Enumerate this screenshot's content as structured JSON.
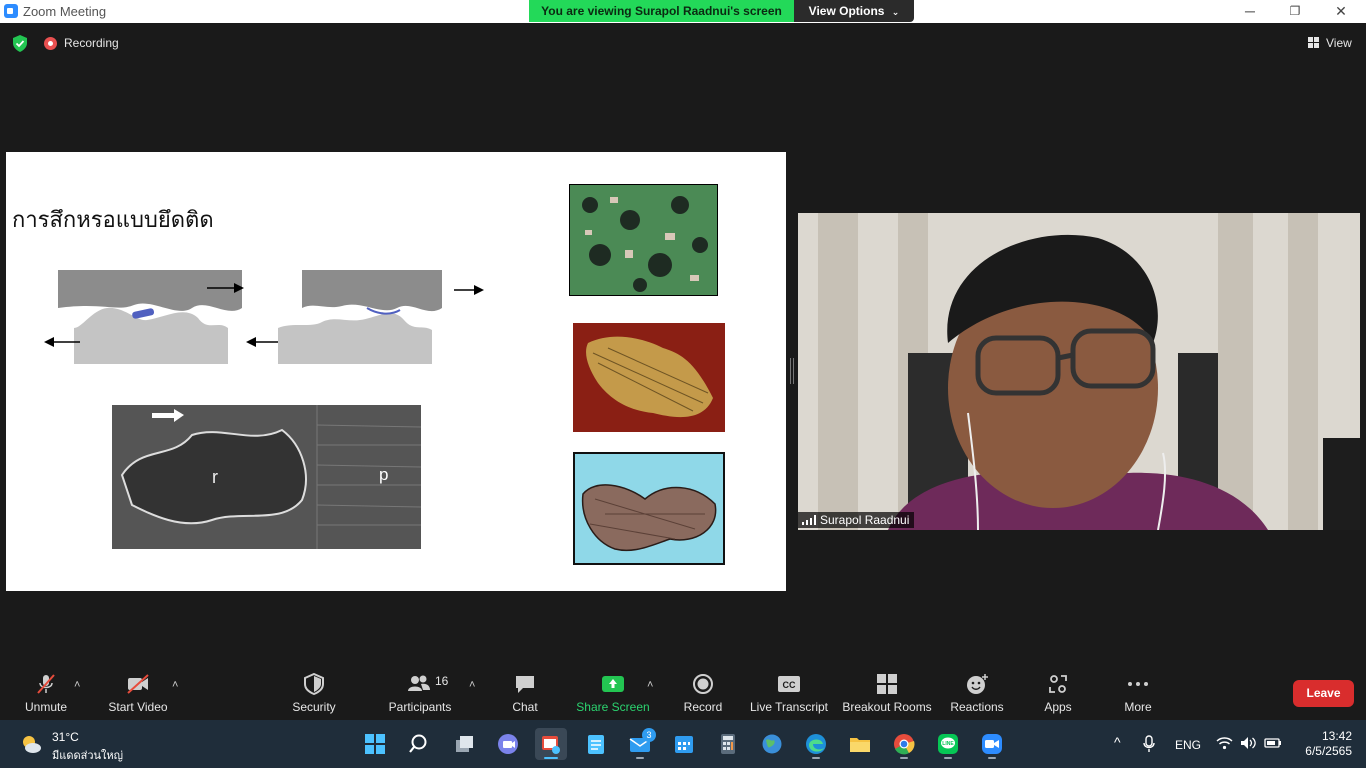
{
  "window": {
    "title": "Zoom Meeting",
    "minimize": "─",
    "restore": "❐",
    "close": "✕"
  },
  "banner": {
    "viewing_text": "You are viewing Surapol Raadnui's screen",
    "view_options": "View Options"
  },
  "status": {
    "recording": "Recording",
    "view": "View"
  },
  "slide": {
    "title": "การสึกหรอแบบยึดติด",
    "sem_label_r": "r",
    "sem_label_p": "p"
  },
  "participant": {
    "name": "Surapol Raadnui"
  },
  "toolbar": {
    "unmute": "Unmute",
    "start_video": "Start Video",
    "security": "Security",
    "participants": "Participants",
    "participants_count": "16",
    "chat": "Chat",
    "share_screen": "Share Screen",
    "record": "Record",
    "live_transcript": "Live Transcript",
    "breakout_rooms": "Breakout Rooms",
    "reactions": "Reactions",
    "apps": "Apps",
    "more": "More",
    "leave": "Leave",
    "caret": "˄"
  },
  "taskbar": {
    "weather_temp": "31°C",
    "weather_cond": "มีแดดส่วนใหญ่",
    "mail_badge": "3",
    "language": "ENG",
    "time": "13:42",
    "date": "6/5/2565",
    "tray_chevron": "^"
  },
  "colors": {
    "accent_green": "#23d959",
    "leave_red": "#d92d2d",
    "share_green": "#2bd36f",
    "zoom_blue": "#2d8cff"
  }
}
